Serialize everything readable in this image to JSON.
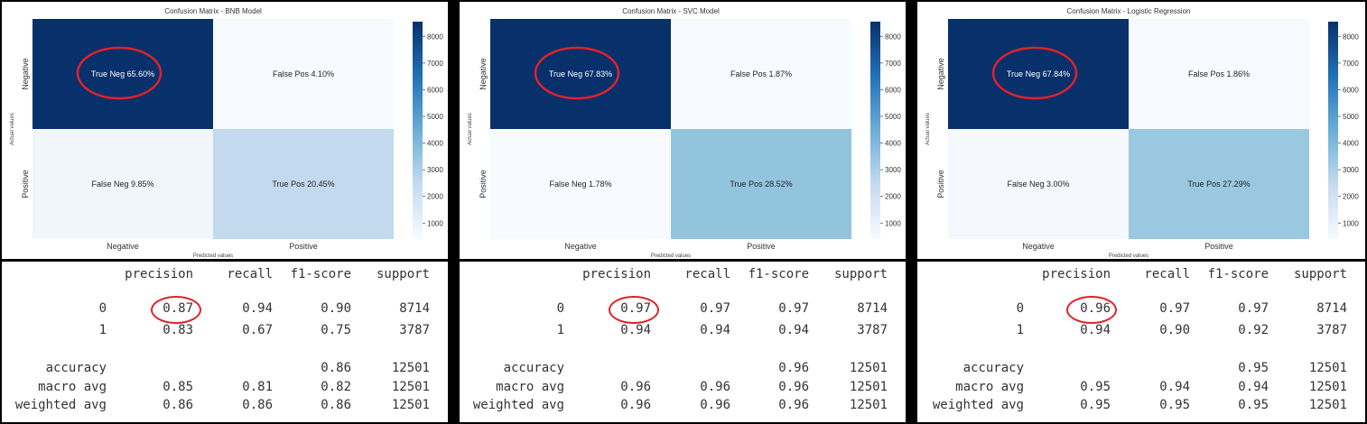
{
  "panels": [
    {
      "title": "Confusion Matrix - BNB Model",
      "x_tick_labels": [
        "Negative",
        "Positive"
      ],
      "y_tick_labels": [
        "Negative",
        "Positive"
      ],
      "xlabel": "Predicted values",
      "ylabel": "Actual values",
      "cells": [
        {
          "label": "True Neg  65.60%",
          "fraction": 0.656,
          "color": "#08306b",
          "text_color": "#ffffff",
          "circled": true
        },
        {
          "label": "False Pos  4.10%",
          "fraction": 0.041,
          "color": "#f7fbff",
          "text_color": "#222222",
          "circled": false
        },
        {
          "label": "False Neg  9.85%",
          "fraction": 0.0985,
          "color": "#f1f6fc",
          "text_color": "#222222",
          "circled": false
        },
        {
          "label": "True Pos  20.45%",
          "fraction": 0.2045,
          "color": "#c3d9ee",
          "text_color": "#222222",
          "circled": false
        }
      ],
      "colorbar_ticks": [
        "1000",
        "2000",
        "3000",
        "4000",
        "5000",
        "6000",
        "7000",
        "8000"
      ]
    },
    {
      "title": "Confusion Matrix - SVC Model",
      "x_tick_labels": [
        "Negative",
        "Positive"
      ],
      "y_tick_labels": [
        "Negative",
        "Positive"
      ],
      "xlabel": "Predicted values",
      "ylabel": "Actual values",
      "cells": [
        {
          "label": "True Neg  67.83%",
          "fraction": 0.6783,
          "color": "#08306b",
          "text_color": "#ffffff",
          "circled": true
        },
        {
          "label": "False Pos  1.87%",
          "fraction": 0.0187,
          "color": "#f7fbff",
          "text_color": "#222222",
          "circled": false
        },
        {
          "label": "False Neg  1.78%",
          "fraction": 0.0178,
          "color": "#f7fbff",
          "text_color": "#222222",
          "circled": false
        },
        {
          "label": "True Pos  28.52%",
          "fraction": 0.2852,
          "color": "#93c4de",
          "text_color": "#222222",
          "circled": false
        }
      ],
      "colorbar_ticks": [
        "1000",
        "2000",
        "3000",
        "4000",
        "5000",
        "6000",
        "7000",
        "8000"
      ]
    },
    {
      "title": "Confusion Matrix - Logistic Regression",
      "x_tick_labels": [
        "Negative",
        "Positive"
      ],
      "y_tick_labels": [
        "Negative",
        "Positive"
      ],
      "xlabel": "Predicted values",
      "ylabel": "Actual values",
      "cells": [
        {
          "label": "True Neg  67.84%",
          "fraction": 0.6784,
          "color": "#08306b",
          "text_color": "#ffffff",
          "circled": true
        },
        {
          "label": "False Pos  1.86%",
          "fraction": 0.0186,
          "color": "#f7fbff",
          "text_color": "#222222",
          "circled": false
        },
        {
          "label": "False Neg  3.00%",
          "fraction": 0.03,
          "color": "#f5f9fe",
          "text_color": "#222222",
          "circled": false
        },
        {
          "label": "True Pos  27.29%",
          "fraction": 0.2729,
          "color": "#9ac8e0",
          "text_color": "#222222",
          "circled": false
        }
      ],
      "colorbar_ticks": [
        "1000",
        "2000",
        "3000",
        "4000",
        "5000",
        "6000",
        "7000",
        "8000"
      ]
    }
  ],
  "reports": [
    {
      "headers": [
        "precision",
        "recall",
        "f1-score",
        "support"
      ],
      "rows": [
        {
          "label": "0",
          "values": [
            "0.87",
            "0.94",
            "0.90",
            "8714"
          ]
        },
        {
          "label": "1",
          "values": [
            "0.83",
            "0.67",
            "0.75",
            "3787"
          ]
        },
        {
          "label": "accuracy",
          "values": [
            "",
            "",
            "0.86",
            "12501"
          ]
        },
        {
          "label": "macro avg",
          "values": [
            "0.85",
            "0.81",
            "0.82",
            "12501"
          ]
        },
        {
          "label": "weighted avg",
          "values": [
            "0.86",
            "0.86",
            "0.86",
            "12501"
          ]
        }
      ],
      "circled_value": "0.87"
    },
    {
      "headers": [
        "precision",
        "recall",
        "f1-score",
        "support"
      ],
      "rows": [
        {
          "label": "0",
          "values": [
            "0.97",
            "0.97",
            "0.97",
            "8714"
          ]
        },
        {
          "label": "1",
          "values": [
            "0.94",
            "0.94",
            "0.94",
            "3787"
          ]
        },
        {
          "label": "accuracy",
          "values": [
            "",
            "",
            "0.96",
            "12501"
          ]
        },
        {
          "label": "macro avg",
          "values": [
            "0.96",
            "0.96",
            "0.96",
            "12501"
          ]
        },
        {
          "label": "weighted avg",
          "values": [
            "0.96",
            "0.96",
            "0.96",
            "12501"
          ]
        }
      ],
      "circled_value": "0.97"
    },
    {
      "headers": [
        "precision",
        "recall",
        "f1-score",
        "support"
      ],
      "rows": [
        {
          "label": "0",
          "values": [
            "0.96",
            "0.97",
            "0.97",
            "8714"
          ]
        },
        {
          "label": "1",
          "values": [
            "0.94",
            "0.90",
            "0.92",
            "3787"
          ]
        },
        {
          "label": "accuracy",
          "values": [
            "",
            "",
            "0.95",
            "12501"
          ]
        },
        {
          "label": "macro avg",
          "values": [
            "0.95",
            "0.94",
            "0.94",
            "12501"
          ]
        },
        {
          "label": "weighted avg",
          "values": [
            "0.95",
            "0.95",
            "0.95",
            "12501"
          ]
        }
      ],
      "circled_value": "0.96"
    }
  ],
  "chart_data": [
    {
      "type": "heatmap",
      "title": "Confusion Matrix - BNB Model",
      "xlabel": "Predicted values",
      "ylabel": "Actual values",
      "x_categories": [
        "Negative",
        "Positive"
      ],
      "y_categories": [
        "Negative",
        "Positive"
      ],
      "values": [
        [
          65.6,
          4.1
        ],
        [
          9.85,
          20.45
        ]
      ],
      "colorbar_range": [
        1000,
        8000
      ],
      "colormap": "Blues"
    },
    {
      "type": "heatmap",
      "title": "Confusion Matrix - SVC Model",
      "xlabel": "Predicted values",
      "ylabel": "Actual values",
      "x_categories": [
        "Negative",
        "Positive"
      ],
      "y_categories": [
        "Negative",
        "Positive"
      ],
      "values": [
        [
          67.83,
          1.87
        ],
        [
          1.78,
          28.52
        ]
      ],
      "colorbar_range": [
        1000,
        8000
      ],
      "colormap": "Blues"
    },
    {
      "type": "heatmap",
      "title": "Confusion Matrix - Logistic Regression",
      "xlabel": "Predicted values",
      "ylabel": "Actual values",
      "x_categories": [
        "Negative",
        "Positive"
      ],
      "y_categories": [
        "Negative",
        "Positive"
      ],
      "values": [
        [
          67.84,
          1.86
        ],
        [
          3.0,
          27.29
        ]
      ],
      "colorbar_range": [
        1000,
        8000
      ],
      "colormap": "Blues"
    },
    {
      "type": "table",
      "title": "",
      "columns": [
        "",
        "precision",
        "recall",
        "f1-score",
        "support"
      ],
      "rows": [
        [
          "0",
          0.87,
          0.94,
          0.9,
          8714
        ],
        [
          "1",
          0.83,
          0.67,
          0.75,
          3787
        ],
        [
          "accuracy",
          null,
          null,
          0.86,
          12501
        ],
        [
          "macro avg",
          0.85,
          0.81,
          0.82,
          12501
        ],
        [
          "weighted avg",
          0.86,
          0.86,
          0.86,
          12501
        ]
      ]
    },
    {
      "type": "table",
      "title": "",
      "columns": [
        "",
        "precision",
        "recall",
        "f1-score",
        "support"
      ],
      "rows": [
        [
          "0",
          0.97,
          0.97,
          0.97,
          8714
        ],
        [
          "1",
          0.94,
          0.94,
          0.94,
          3787
        ],
        [
          "accuracy",
          null,
          null,
          0.96,
          12501
        ],
        [
          "macro avg",
          0.96,
          0.96,
          0.96,
          12501
        ],
        [
          "weighted avg",
          0.96,
          0.96,
          0.96,
          12501
        ]
      ]
    },
    {
      "type": "table",
      "title": "",
      "columns": [
        "",
        "precision",
        "recall",
        "f1-score",
        "support"
      ],
      "rows": [
        [
          "0",
          0.96,
          0.97,
          0.97,
          8714
        ],
        [
          "1",
          0.94,
          0.9,
          0.92,
          3787
        ],
        [
          "accuracy",
          null,
          null,
          0.95,
          12501
        ],
        [
          "macro avg",
          0.95,
          0.94,
          0.94,
          12501
        ],
        [
          "weighted avg",
          0.95,
          0.95,
          0.95,
          12501
        ]
      ]
    }
  ]
}
